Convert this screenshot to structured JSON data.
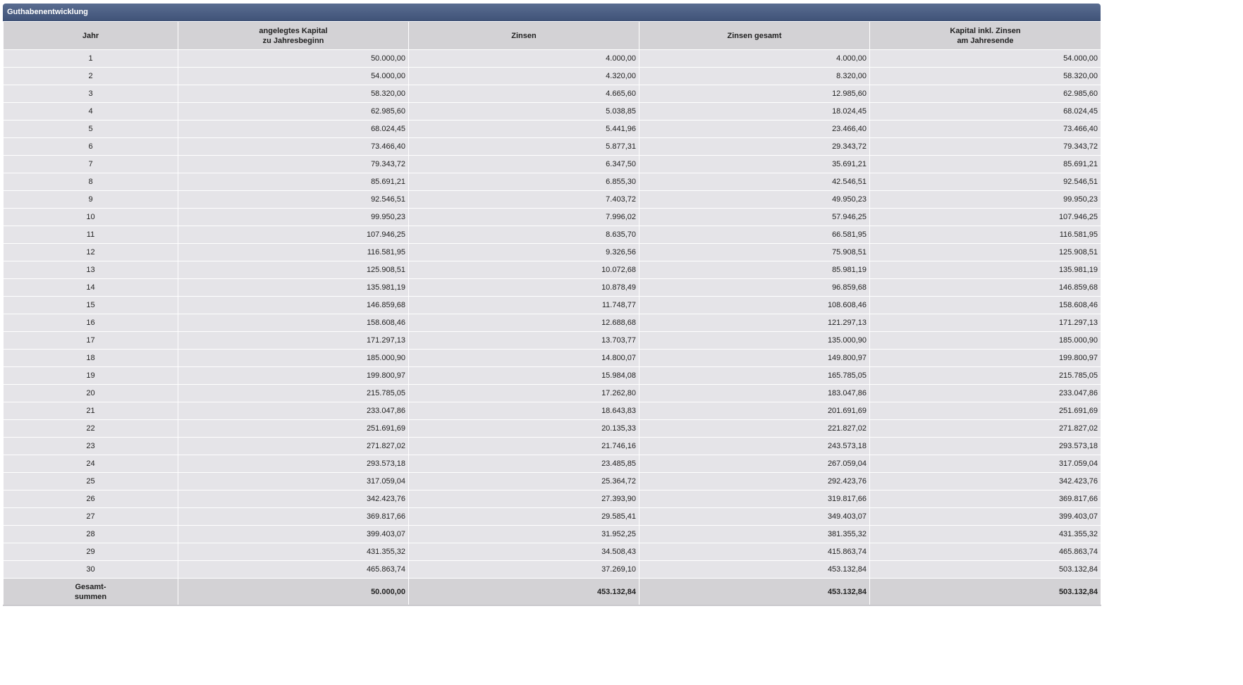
{
  "panel": {
    "title": "Guthabenentwicklung"
  },
  "table": {
    "headers": [
      "Jahr",
      "angelegtes Kapital\nzu Jahresbeginn",
      "Zinsen",
      "Zinsen gesamt",
      "Kapital inkl. Zinsen\nam Jahresende"
    ],
    "rows": [
      [
        "1",
        "50.000,00",
        "4.000,00",
        "4.000,00",
        "54.000,00"
      ],
      [
        "2",
        "54.000,00",
        "4.320,00",
        "8.320,00",
        "58.320,00"
      ],
      [
        "3",
        "58.320,00",
        "4.665,60",
        "12.985,60",
        "62.985,60"
      ],
      [
        "4",
        "62.985,60",
        "5.038,85",
        "18.024,45",
        "68.024,45"
      ],
      [
        "5",
        "68.024,45",
        "5.441,96",
        "23.466,40",
        "73.466,40"
      ],
      [
        "6",
        "73.466,40",
        "5.877,31",
        "29.343,72",
        "79.343,72"
      ],
      [
        "7",
        "79.343,72",
        "6.347,50",
        "35.691,21",
        "85.691,21"
      ],
      [
        "8",
        "85.691,21",
        "6.855,30",
        "42.546,51",
        "92.546,51"
      ],
      [
        "9",
        "92.546,51",
        "7.403,72",
        "49.950,23",
        "99.950,23"
      ],
      [
        "10",
        "99.950,23",
        "7.996,02",
        "57.946,25",
        "107.946,25"
      ],
      [
        "11",
        "107.946,25",
        "8.635,70",
        "66.581,95",
        "116.581,95"
      ],
      [
        "12",
        "116.581,95",
        "9.326,56",
        "75.908,51",
        "125.908,51"
      ],
      [
        "13",
        "125.908,51",
        "10.072,68",
        "85.981,19",
        "135.981,19"
      ],
      [
        "14",
        "135.981,19",
        "10.878,49",
        "96.859,68",
        "146.859,68"
      ],
      [
        "15",
        "146.859,68",
        "11.748,77",
        "108.608,46",
        "158.608,46"
      ],
      [
        "16",
        "158.608,46",
        "12.688,68",
        "121.297,13",
        "171.297,13"
      ],
      [
        "17",
        "171.297,13",
        "13.703,77",
        "135.000,90",
        "185.000,90"
      ],
      [
        "18",
        "185.000,90",
        "14.800,07",
        "149.800,97",
        "199.800,97"
      ],
      [
        "19",
        "199.800,97",
        "15.984,08",
        "165.785,05",
        "215.785,05"
      ],
      [
        "20",
        "215.785,05",
        "17.262,80",
        "183.047,86",
        "233.047,86"
      ],
      [
        "21",
        "233.047,86",
        "18.643,83",
        "201.691,69",
        "251.691,69"
      ],
      [
        "22",
        "251.691,69",
        "20.135,33",
        "221.827,02",
        "271.827,02"
      ],
      [
        "23",
        "271.827,02",
        "21.746,16",
        "243.573,18",
        "293.573,18"
      ],
      [
        "24",
        "293.573,18",
        "23.485,85",
        "267.059,04",
        "317.059,04"
      ],
      [
        "25",
        "317.059,04",
        "25.364,72",
        "292.423,76",
        "342.423,76"
      ],
      [
        "26",
        "342.423,76",
        "27.393,90",
        "319.817,66",
        "369.817,66"
      ],
      [
        "27",
        "369.817,66",
        "29.585,41",
        "349.403,07",
        "399.403,07"
      ],
      [
        "28",
        "399.403,07",
        "31.952,25",
        "381.355,32",
        "431.355,32"
      ],
      [
        "29",
        "431.355,32",
        "34.508,43",
        "415.863,74",
        "465.863,74"
      ],
      [
        "30",
        "465.863,74",
        "37.269,10",
        "453.132,84",
        "503.132,84"
      ]
    ],
    "totals": {
      "label": "Gesamt-\nsummen",
      "values": [
        "50.000,00",
        "453.132,84",
        "453.132,84",
        "503.132,84"
      ]
    }
  }
}
